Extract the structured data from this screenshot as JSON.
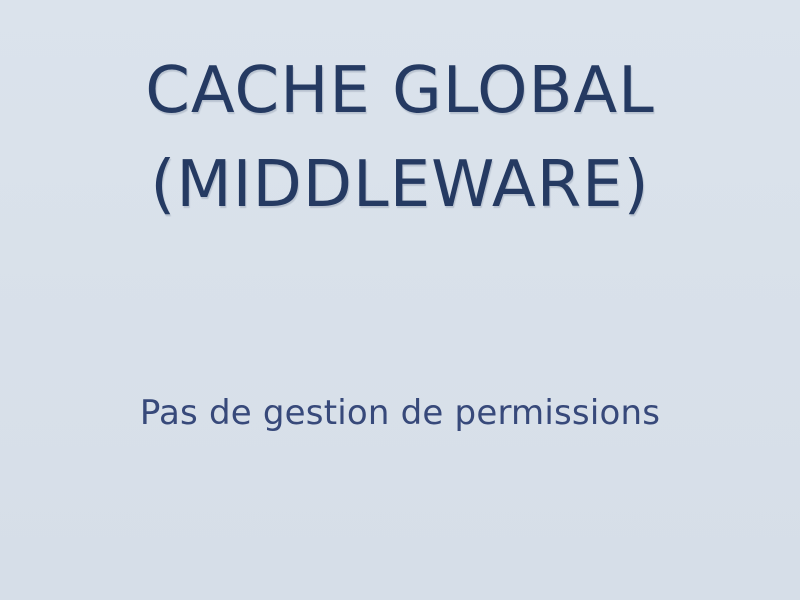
{
  "slide": {
    "title_line1": "CACHE GLOBAL",
    "title_line2": "(MIDDLEWARE)",
    "subtitle": "Pas de gestion de permissions"
  }
}
